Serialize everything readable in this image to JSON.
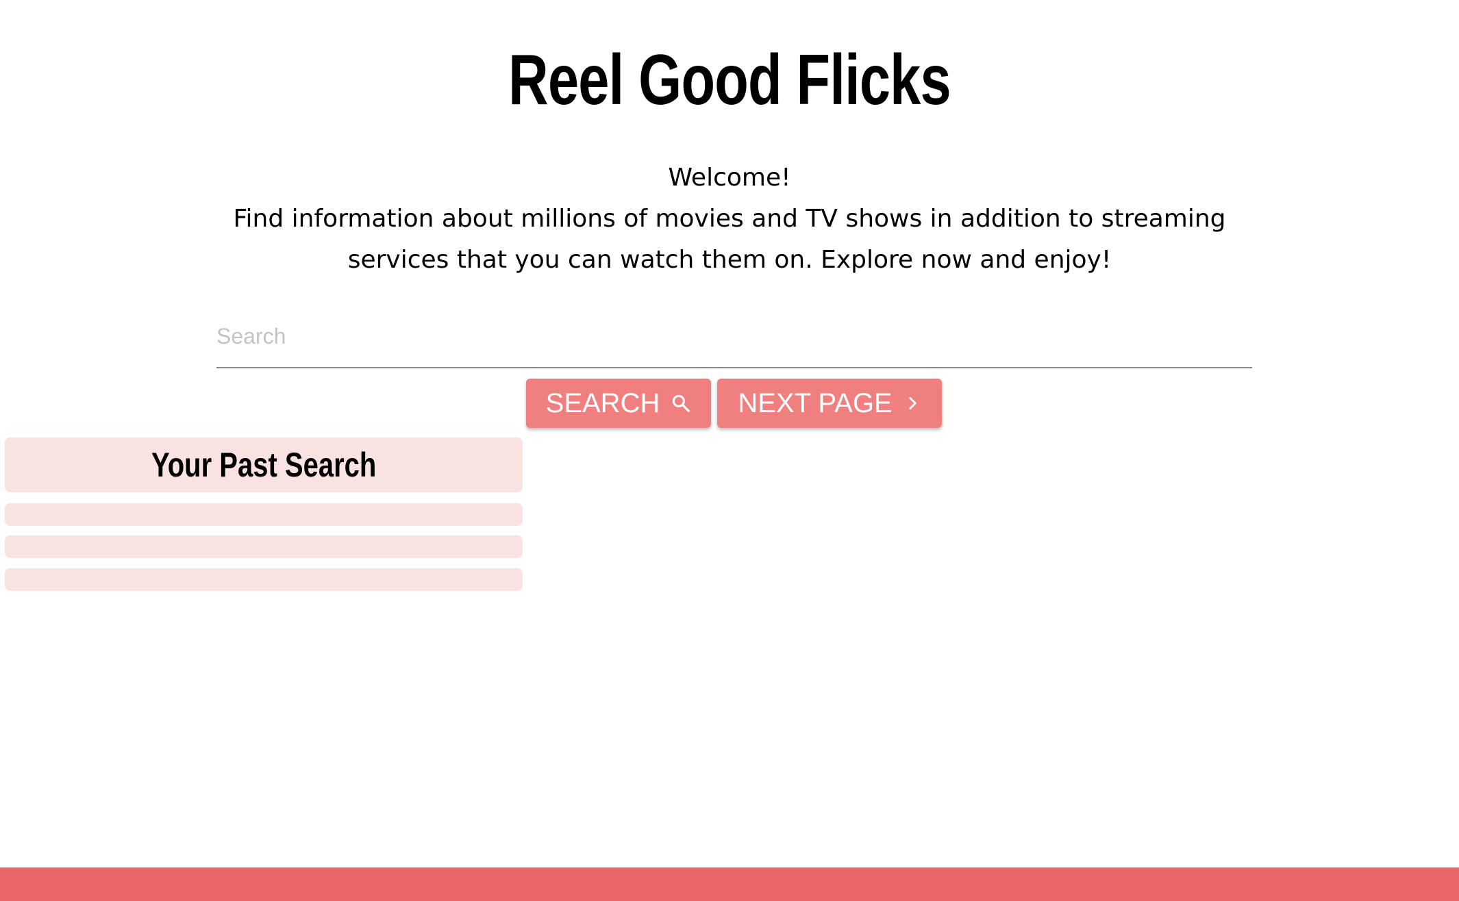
{
  "header": {
    "title": "Reel Good Flicks"
  },
  "intro": {
    "welcome": "Welcome!",
    "description": "Find information about millions of movies and TV shows in addition to streaming services that you can watch them on. Explore now and enjoy!"
  },
  "search": {
    "placeholder": "Search",
    "value": ""
  },
  "buttons": {
    "search_label": "SEARCH",
    "search_icon": "search-icon",
    "next_label": "NEXT PAGE",
    "next_icon": "chevron-right-icon"
  },
  "past_search": {
    "title": "Your Past Search",
    "items": [
      "",
      "",
      ""
    ]
  },
  "colors": {
    "accent": "#f08080",
    "footer": "#ea6767",
    "panel": "#f8e2e2"
  }
}
